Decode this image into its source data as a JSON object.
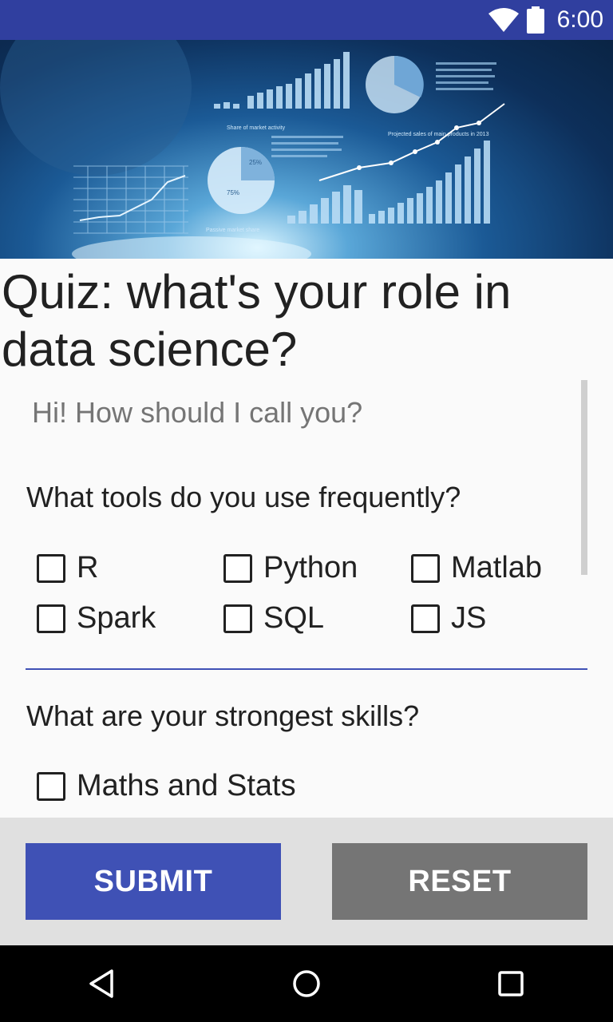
{
  "status_bar": {
    "time": "6:00",
    "icons": [
      "wifi-icon",
      "battery-icon"
    ]
  },
  "hero": {
    "labels": {
      "share_market_activity": "Share of market activity",
      "passive_market_share": "Passive market share",
      "projected_sales": "Projected sales of main products in 2013",
      "pct_25": "25%",
      "pct_75": "75%"
    }
  },
  "quiz": {
    "title": "Quiz: what's your role in data science?",
    "name_placeholder": "Hi! How should I call you?",
    "q_tools": "What tools do you use frequently?",
    "tools": [
      "R",
      "Python",
      "Matlab",
      "Spark",
      "SQL",
      "JS"
    ],
    "q_skills": "What are your strongest skills?",
    "skills": [
      "Maths and Stats"
    ]
  },
  "buttons": {
    "submit": "SUBMIT",
    "reset": "RESET"
  },
  "colors": {
    "primary": "#3f51b5",
    "primary_dark": "#303f9f",
    "reset": "#757575"
  }
}
